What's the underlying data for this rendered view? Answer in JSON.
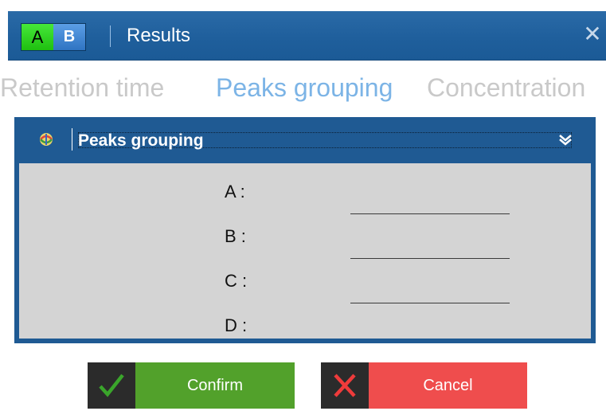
{
  "window": {
    "badge_a": "A",
    "badge_b": "B",
    "title": "Results",
    "close_icon": "close-icon",
    "close_glyph": "✕"
  },
  "tabs": [
    {
      "label": "Retention time",
      "active": false
    },
    {
      "label": "Peaks grouping",
      "active": true
    },
    {
      "label": "Concentration",
      "active": false
    }
  ],
  "group": {
    "title": "Peaks grouping",
    "icon": "chromatography-icon",
    "collapse_icon": "chevron-down-icon",
    "fields": [
      {
        "label": "A :",
        "value": ""
      },
      {
        "label": "B :",
        "value": ""
      },
      {
        "label": "C :",
        "value": ""
      },
      {
        "label": "D :",
        "value": ""
      }
    ]
  },
  "buttons": {
    "confirm": {
      "label": "Confirm",
      "icon": "checkmark-icon",
      "color": "#52a12b"
    },
    "cancel": {
      "label": "Cancel",
      "icon": "x-icon",
      "color": "#ef4d4d"
    }
  },
  "colors": {
    "titlebar": "#1f5f9c",
    "active_tab": "#7cb4e6",
    "inactive_tab": "#c9c9c9",
    "panel": "#d4d4d4"
  }
}
